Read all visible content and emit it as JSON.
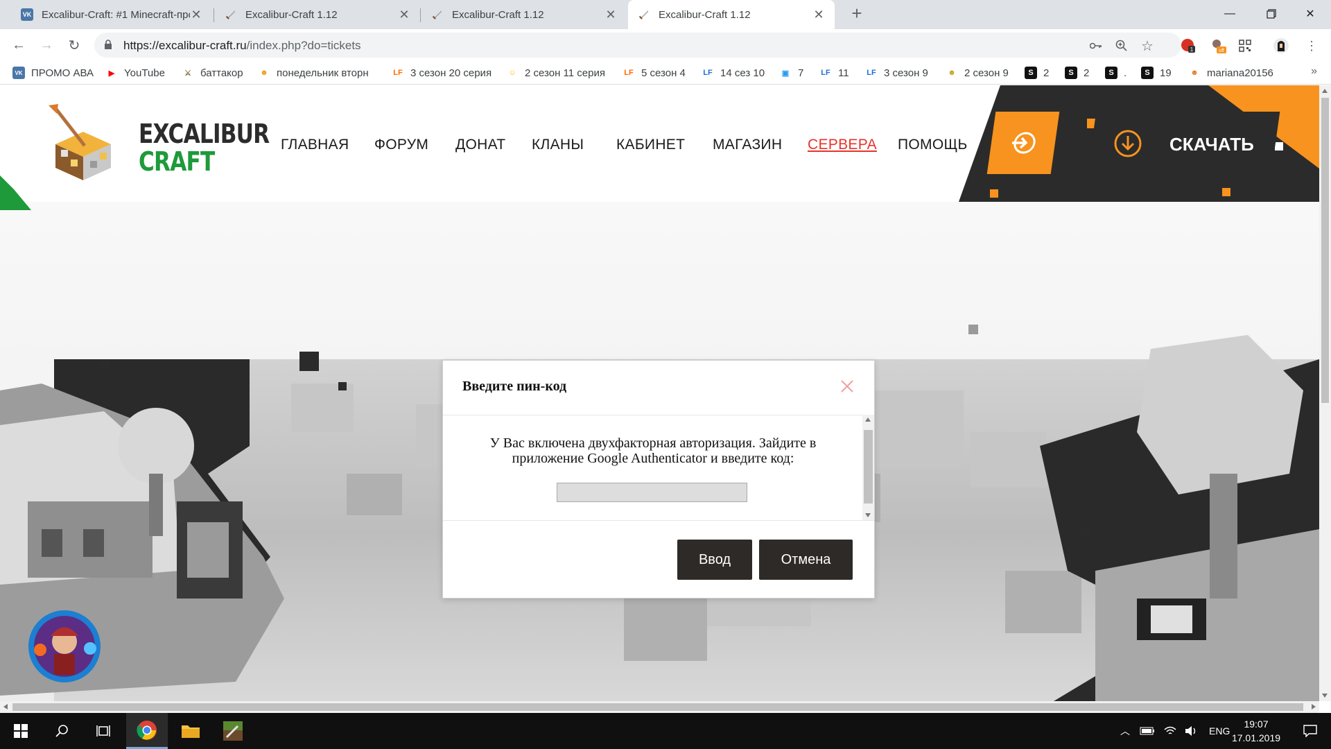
{
  "tabs": [
    {
      "title": "Excalibur-Craft: #1 Minecraft-про",
      "icon": "vk-icon",
      "active": false
    },
    {
      "title": "Excalibur-Craft 1.12",
      "icon": "sword-icon",
      "active": false
    },
    {
      "title": "Excalibur-Craft 1.12",
      "icon": "sword-icon",
      "active": false
    },
    {
      "title": "Excalibur-Craft 1.12",
      "icon": "sword-icon",
      "active": true
    }
  ],
  "address": {
    "host": "https://excalibur-craft.ru",
    "path": "/index.php?do=tickets"
  },
  "bookmarks": [
    {
      "label": "ПРОМО АВА",
      "icon": "VK",
      "color": "#4a76a8"
    },
    {
      "label": "YouTube",
      "icon": "▶",
      "color": "#ff0000"
    },
    {
      "label": "баттакор",
      "icon": "⚔",
      "color": "#8a6d3b"
    },
    {
      "label": "понедельник вторн",
      "icon": "☻",
      "color": "#f39c12"
    },
    {
      "label": "3 сезон 20 серия",
      "icon": "LF",
      "color": "#ff6a00"
    },
    {
      "label": "2 сезон 11 серия",
      "icon": "☺",
      "color": "#f1c40f"
    },
    {
      "label": "5 сезон 4",
      "icon": "LF",
      "color": "#ff6a00"
    },
    {
      "label": "14 сез 10",
      "icon": "LF",
      "color": "#1e6fd9"
    },
    {
      "label": "7",
      "icon": "▣",
      "color": "#2a9df4"
    },
    {
      "label": "11",
      "icon": "LF",
      "color": "#1e6fd9"
    },
    {
      "label": "3 сезон 9",
      "icon": "LF",
      "color": "#1e6fd9"
    },
    {
      "label": "2 сезон 9",
      "icon": "☻",
      "color": "#c9a227"
    },
    {
      "label": "2",
      "icon": "S",
      "color": "#111111"
    },
    {
      "label": "2",
      "icon": "S",
      "color": "#111111"
    },
    {
      "label": ".",
      "icon": "S",
      "color": "#111111"
    },
    {
      "label": "19",
      "icon": "S",
      "color": "#111111"
    },
    {
      "label": "mariana20156",
      "icon": "☻",
      "color": "#e67e22"
    }
  ],
  "bookmarks_more": "»",
  "site": {
    "logo_line1": "EXCALIBUR",
    "logo_line2": "CRAFT",
    "menu": [
      {
        "label": "ГЛАВНАЯ",
        "active": false
      },
      {
        "label": "ФОРУМ",
        "active": false
      },
      {
        "label": "ДОНАТ",
        "active": false
      },
      {
        "label": "КЛАНЫ",
        "active": false
      },
      {
        "label": "КАБИНЕТ",
        "active": false
      },
      {
        "label": "МАГАЗИН",
        "active": false
      },
      {
        "label": "СЕРВЕРА",
        "active": true
      },
      {
        "label": "ПОМОЩЬ",
        "active": false
      }
    ],
    "download_label": "СКАЧАТЬ",
    "accent_orange": "#f7931e",
    "accent_green": "#1e9a3a",
    "active_menu_color": "#e6332a"
  },
  "modal": {
    "title": "Введите пин-код",
    "message": "У Вас включена двухфакторная авторизация. Зайдите в приложение Google Authenticator и введите код:",
    "pin_value": "",
    "submit_label": "Ввод",
    "cancel_label": "Отмена"
  },
  "taskbar": {
    "language": "ENG",
    "time": "19:07",
    "date": "17.01.2019"
  }
}
